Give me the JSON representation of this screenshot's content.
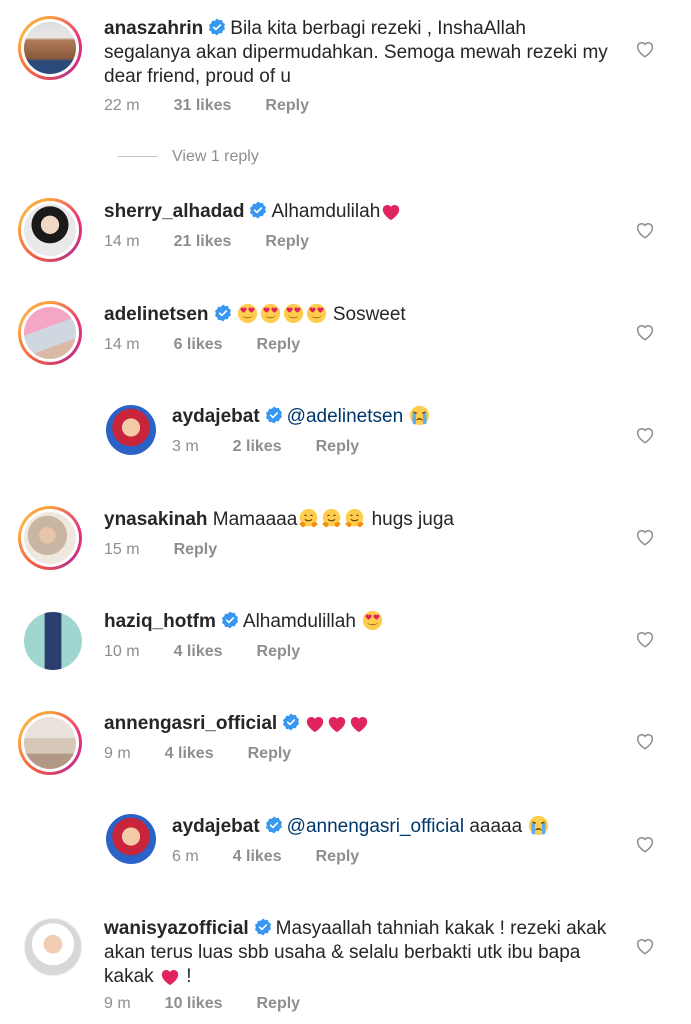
{
  "comments": [
    {
      "username": "anaszahrin",
      "verified": true,
      "text_lines": [
        "Bila kita berbagi rezeki , InshaAllah",
        "segalanya akan dipermudahkan. Semoga mewah rezeki my",
        "dear friend, proud of u"
      ],
      "time": "22 m",
      "likes": "31 likes",
      "reply": "Reply"
    },
    {
      "username": "sherry_alhadad",
      "verified": true,
      "text": "Alhamdulilah",
      "time": "14 m",
      "likes": "21 likes",
      "reply": "Reply"
    },
    {
      "username": "adelinetsen",
      "verified": true,
      "text": "Sosweet",
      "time": "14 m",
      "likes": "6 likes",
      "reply": "Reply"
    },
    {
      "username": "aydajebat",
      "verified": true,
      "mention": "@adelinetsen",
      "time": "3 m",
      "likes": "2 likes",
      "reply": "Reply"
    },
    {
      "username": "ynasakinah",
      "verified": false,
      "text_before": "Mamaaaa",
      "text_after": "hugs juga",
      "time": "15 m",
      "reply": "Reply"
    },
    {
      "username": "haziq_hotfm",
      "verified": true,
      "text": "Alhamdulillah",
      "time": "10 m",
      "likes": "4 likes",
      "reply": "Reply"
    },
    {
      "username": "annengasri_official",
      "verified": true,
      "time": "9 m",
      "likes": "4 likes",
      "reply": "Reply"
    },
    {
      "username": "aydajebat",
      "verified": true,
      "mention": "@annengasri_official",
      "text": "aaaaa",
      "time": "6 m",
      "likes": "4 likes",
      "reply": "Reply"
    },
    {
      "username": "wanisyazofficial",
      "verified": true,
      "text_lines": [
        "Masyaallah tahniah kakak ! rezeki akak",
        "akan terus luas sbb usaha & selalu berbakti utk ibu bapa",
        "kakak",
        "!"
      ],
      "time": "9 m",
      "likes": "10 likes",
      "reply": "Reply"
    }
  ],
  "view_replies": "View 1 reply",
  "colors": {
    "verified": "#3897f0",
    "heart_emoji": "#e0245e",
    "muted": "#8e8e8e",
    "mention": "#00376b"
  },
  "icons": [
    "like-heart-icon",
    "verified-badge-icon"
  ]
}
